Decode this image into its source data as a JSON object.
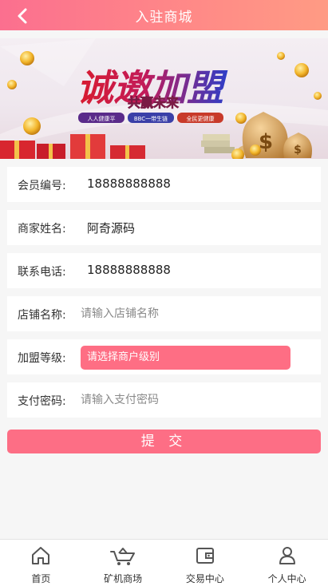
{
  "header": {
    "title": "入驻商城",
    "back_icon": "chevron-left-icon"
  },
  "banner": {
    "headline": "诚邀加盟",
    "subheadline": "共赢未来",
    "pills": [
      "人人健康平",
      "BBC一带生链",
      "全民更健康"
    ]
  },
  "form": {
    "member_id": {
      "label": "会员编号:",
      "value": "18888888888"
    },
    "merchant_name": {
      "label": "商家姓名:",
      "value": "阿奇源码"
    },
    "phone": {
      "label": "联系电话:",
      "value": "18888888888"
    },
    "shop_name": {
      "label": "店铺名称:",
      "placeholder": "请输入店铺名称"
    },
    "level": {
      "label": "加盟等级:",
      "selected": "请选择商户级别"
    },
    "pay_password": {
      "label": "支付密码:",
      "placeholder": "请输入支付密码"
    },
    "submit_label": "提 交"
  },
  "tabbar": [
    {
      "label": "首页",
      "icon": "home-icon"
    },
    {
      "label": "矿机商场",
      "icon": "mining-cart-icon"
    },
    {
      "label": "交易中心",
      "icon": "wallet-icon"
    },
    {
      "label": "个人中心",
      "icon": "user-icon"
    }
  ],
  "colors": {
    "accent": "#fd6e85",
    "header_start": "#fb6f8f",
    "header_end": "#ff9b84"
  }
}
